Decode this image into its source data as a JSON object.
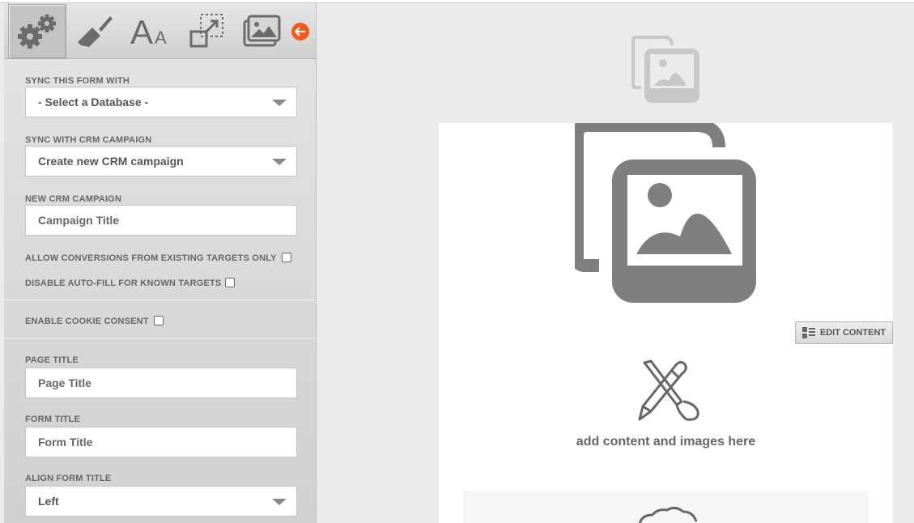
{
  "sidebar": {
    "toolbar": {
      "tools": [
        {
          "icon": "gears-icon",
          "active": true
        },
        {
          "icon": "paintbrush-icon",
          "active": false
        },
        {
          "icon": "font-size-icon",
          "active": false
        },
        {
          "icon": "resize-icon",
          "active": false
        },
        {
          "icon": "image-gallery-icon",
          "active": false
        }
      ],
      "back_icon": "arrow-left-icon",
      "back_color": "#f05a1a"
    },
    "sync_form": {
      "label": "SYNC THIS FORM WITH",
      "selected": "- Select a Database -"
    },
    "sync_crm": {
      "label": "SYNC WITH CRM CAMPAIGN",
      "selected": "Create new CRM campaign"
    },
    "new_crm": {
      "label": "NEW CRM CAMPAIGN",
      "placeholder": "Campaign Title"
    },
    "allow_conversions": {
      "label": "ALLOW CONVERSIONS FROM EXISTING TARGETS ONLY",
      "checked": false
    },
    "disable_autofill": {
      "label": "DISABLE AUTO-FILL FOR KNOWN TARGETS",
      "checked": false
    },
    "cookie_consent": {
      "label": "ENABLE COOKIE CONSENT",
      "checked": false
    },
    "page_title": {
      "label": "PAGE TITLE",
      "placeholder": "Page Title"
    },
    "form_title": {
      "label": "FORM TITLE",
      "placeholder": "Form Title"
    },
    "align_form_title": {
      "label": "ALIGN FORM TITLE",
      "selected": "Left"
    }
  },
  "canvas": {
    "header_image_icon": "images-icon",
    "main_image_icon": "images-icon",
    "edit_button": {
      "icon": "list-layout-icon",
      "label": "EDIT CONTENT"
    },
    "content_icon": "pencil-brush-icon",
    "add_content_text": "add content and images here",
    "lower_icon": "cloud-icon"
  }
}
